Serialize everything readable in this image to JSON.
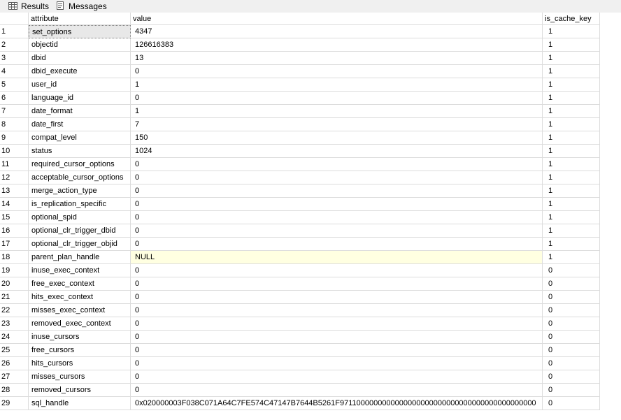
{
  "tabs": [
    {
      "label": "Results",
      "icon": "grid-icon"
    },
    {
      "label": "Messages",
      "icon": "document-icon"
    }
  ],
  "columns": [
    "attribute",
    "value",
    "is_cache_key"
  ],
  "rows": [
    {
      "num": "1",
      "attribute": "set_options",
      "value": "4347",
      "is_cache_key": "1"
    },
    {
      "num": "2",
      "attribute": "objectid",
      "value": "126616383",
      "is_cache_key": "1"
    },
    {
      "num": "3",
      "attribute": "dbid",
      "value": "13",
      "is_cache_key": "1"
    },
    {
      "num": "4",
      "attribute": "dbid_execute",
      "value": "0",
      "is_cache_key": "1"
    },
    {
      "num": "5",
      "attribute": "user_id",
      "value": "1",
      "is_cache_key": "1"
    },
    {
      "num": "6",
      "attribute": "language_id",
      "value": "0",
      "is_cache_key": "1"
    },
    {
      "num": "7",
      "attribute": "date_format",
      "value": "1",
      "is_cache_key": "1"
    },
    {
      "num": "8",
      "attribute": "date_first",
      "value": "7",
      "is_cache_key": "1"
    },
    {
      "num": "9",
      "attribute": "compat_level",
      "value": "150",
      "is_cache_key": "1"
    },
    {
      "num": "10",
      "attribute": "status",
      "value": "1024",
      "is_cache_key": "1"
    },
    {
      "num": "11",
      "attribute": "required_cursor_options",
      "value": "0",
      "is_cache_key": "1"
    },
    {
      "num": "12",
      "attribute": "acceptable_cursor_options",
      "value": "0",
      "is_cache_key": "1"
    },
    {
      "num": "13",
      "attribute": "merge_action_type",
      "value": "0",
      "is_cache_key": "1"
    },
    {
      "num": "14",
      "attribute": "is_replication_specific",
      "value": "0",
      "is_cache_key": "1"
    },
    {
      "num": "15",
      "attribute": "optional_spid",
      "value": "0",
      "is_cache_key": "1"
    },
    {
      "num": "16",
      "attribute": "optional_clr_trigger_dbid",
      "value": "0",
      "is_cache_key": "1"
    },
    {
      "num": "17",
      "attribute": "optional_clr_trigger_objid",
      "value": "0",
      "is_cache_key": "1"
    },
    {
      "num": "18",
      "attribute": "parent_plan_handle",
      "value": "NULL",
      "is_cache_key": "1"
    },
    {
      "num": "19",
      "attribute": "inuse_exec_context",
      "value": "0",
      "is_cache_key": "0"
    },
    {
      "num": "20",
      "attribute": "free_exec_context",
      "value": "0",
      "is_cache_key": "0"
    },
    {
      "num": "21",
      "attribute": "hits_exec_context",
      "value": "0",
      "is_cache_key": "0"
    },
    {
      "num": "22",
      "attribute": "misses_exec_context",
      "value": "0",
      "is_cache_key": "0"
    },
    {
      "num": "23",
      "attribute": "removed_exec_context",
      "value": "0",
      "is_cache_key": "0"
    },
    {
      "num": "24",
      "attribute": "inuse_cursors",
      "value": "0",
      "is_cache_key": "0"
    },
    {
      "num": "25",
      "attribute": "free_cursors",
      "value": "0",
      "is_cache_key": "0"
    },
    {
      "num": "26",
      "attribute": "hits_cursors",
      "value": "0",
      "is_cache_key": "0"
    },
    {
      "num": "27",
      "attribute": "misses_cursors",
      "value": "0",
      "is_cache_key": "0"
    },
    {
      "num": "28",
      "attribute": "removed_cursors",
      "value": "0",
      "is_cache_key": "0"
    },
    {
      "num": "29",
      "attribute": "sql_handle",
      "value": "0x020000003F038C071A64C7FE574C47147B7644B5261F9711000000000000000000000000000000000000000000",
      "is_cache_key": "0"
    }
  ],
  "selected_row": 1,
  "colors": {
    "null_cell": "#ffffe1",
    "selected_cell": "#e8e8e8",
    "grid_line": "#dcdcdc"
  }
}
